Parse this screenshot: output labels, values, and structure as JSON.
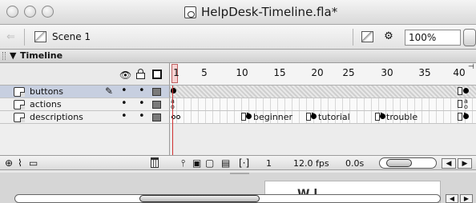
{
  "window": {
    "title": "HelpDesk-Timeline.fla*"
  },
  "scene_bar": {
    "back_icon": "back-arrow-icon",
    "scene_label": "Scene 1",
    "zoom_value": "100%"
  },
  "timeline": {
    "panel_title": "Timeline",
    "toggle_glyph": "▼",
    "ruler_ticks": [
      "1",
      "5",
      "10",
      "15",
      "20",
      "25",
      "30",
      "35",
      "40"
    ],
    "layers": [
      {
        "name": "buttons",
        "selected": true,
        "editing": true
      },
      {
        "name": "actions",
        "selected": false,
        "editing": false
      },
      {
        "name": "descriptions",
        "selected": false,
        "editing": false
      }
    ],
    "frame_labels": [
      "beginner",
      "tutorial",
      "trouble"
    ],
    "status": {
      "current_frame": "1",
      "fps": "12.0 fps",
      "elapsed": "0.0s"
    }
  },
  "icons": {
    "eye": "eye-icon",
    "lock": "lock-icon",
    "outline": "outline-icon",
    "add_layer": "add-layer-icon",
    "add_guide": "add-motion-guide-icon",
    "add_folder": "add-folder-icon",
    "trash": "trash-icon",
    "center_frame": "center-frame-icon",
    "onion": "onion-skin-icon",
    "onion_outline": "onion-skin-outline-icon",
    "edit_multiple": "edit-multiple-frames-icon",
    "onion_markers": "onion-markers-icon"
  },
  "stage": {
    "partial_text": "W l"
  },
  "colors": {
    "selected_row": "#c7cfe0",
    "playhead": "#d03030"
  }
}
